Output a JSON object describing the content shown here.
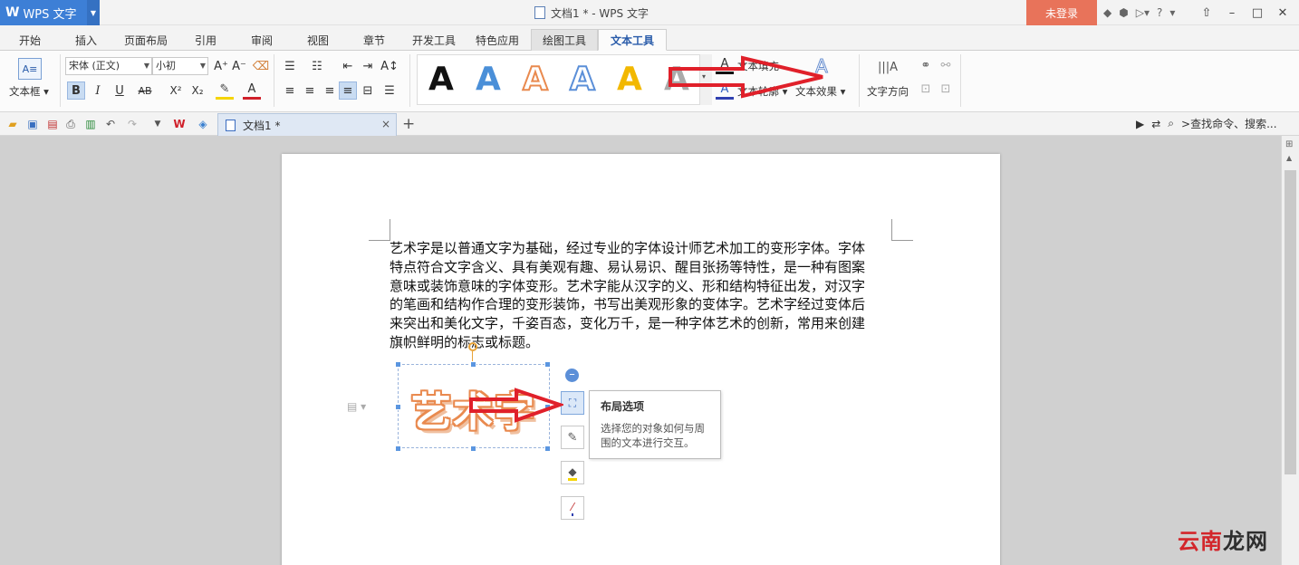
{
  "titlebar": {
    "app_logo": "W",
    "app_name": "WPS 文字",
    "window_title": "文档1 * - WPS 文字",
    "login_label": "未登录",
    "help_label": "?"
  },
  "menu_tabs": [
    "开始",
    "插入",
    "页面布局",
    "引用",
    "审阅",
    "视图",
    "章节",
    "开发工具",
    "特色应用",
    "绘图工具",
    "文本工具"
  ],
  "ribbon": {
    "textbox_label": "文本框",
    "font_name": "宋体 (正文)",
    "font_size": "小初",
    "text_fill_label": "文本填充",
    "text_outline_label": "文本轮廓",
    "text_effect_label": "文本效果",
    "text_direction_label": "文字方向",
    "gallery_letter": "A",
    "gallery_colors": [
      "#111111",
      "#4a8fd8",
      "#e98a4f",
      "#5b8fd8",
      "#f2b800",
      "#aaaaaa"
    ]
  },
  "quickbar": {
    "doc_tab_label": "文档1 *",
    "close_glyph": "×",
    "add_glyph": "+",
    "search_label": ">查找命令、搜索..."
  },
  "document": {
    "paragraph_lines": [
      "艺术字是以普通文字为基础，经过专业的字体设计师艺术加工的变形字体。字体",
      "特点符合文字含义、具有美观有趣、易认易识、醒目张扬等特性，是一种有图案",
      "意味或装饰意味的字体变形。艺术字能从汉字的义、形和结构特征出发，对汉字",
      "的笔画和结构作合理的变形装饰，书写出美观形象的变体字。艺术字经过变体后",
      "来突出和美化文字，千姿百态，变化万千，是一种字体艺术的创新，常用来创建",
      "旗帜鲜明的标志或标题。"
    ],
    "wordart_text": "艺术字",
    "wordart_color": "#e98a4f"
  },
  "tooltip": {
    "title": "布局选项",
    "body": "选择您的对象如何与周围的文本进行交互。"
  },
  "watermark": {
    "part1": "云南",
    "part2": "龙网"
  },
  "annotation_color": "#e0202a"
}
